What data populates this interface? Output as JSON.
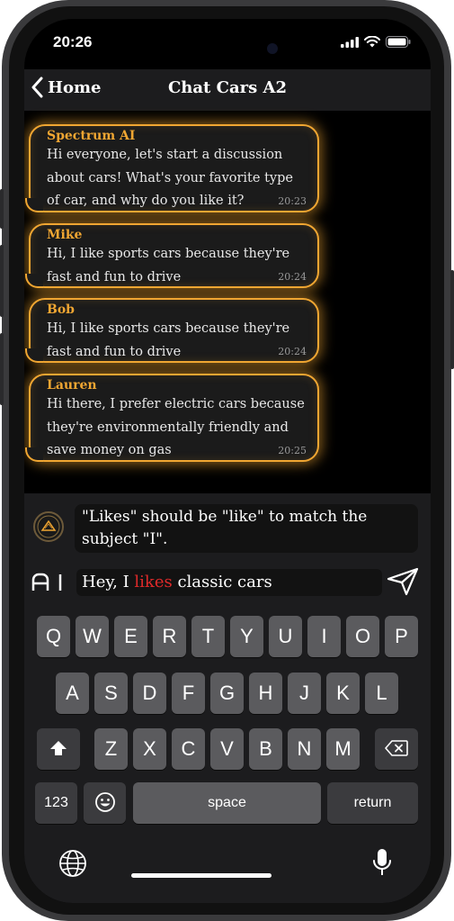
{
  "status": {
    "time": "20:26"
  },
  "nav": {
    "back_label": "Home",
    "title": "Chat Cars A2"
  },
  "messages": [
    {
      "sender": "Spectrum AI",
      "text": "Hi everyone, let's start a discussion about cars! What's your favorite type of car, and why do you like it?",
      "time": "20:23"
    },
    {
      "sender": "Mike",
      "text": "Hi, I like sports cars because they're fast and fun to drive",
      "time": "20:24"
    },
    {
      "sender": "Bob",
      "text": "Hi, I like sports cars because they're fast and fun to drive",
      "time": "20:24"
    },
    {
      "sender": "Lauren",
      "text": "Hi there, I prefer electric cars because they're environmentally friendly and save money on gas",
      "time": "20:25"
    }
  ],
  "correction": {
    "text": "\"Likes\" should be \"like\" to match the subject \"I\"."
  },
  "input": {
    "before": "Hey, I ",
    "error_word": "likes",
    "after": " classic cars"
  },
  "keyboard": {
    "row1": [
      "Q",
      "W",
      "E",
      "R",
      "T",
      "Y",
      "U",
      "I",
      "O",
      "P"
    ],
    "row2": [
      "A",
      "S",
      "D",
      "F",
      "G",
      "H",
      "J",
      "K",
      "L"
    ],
    "row3": [
      "Z",
      "X",
      "C",
      "V",
      "B",
      "N",
      "M"
    ],
    "numbers_label": "123",
    "space_label": "space",
    "return_label": "return"
  },
  "colors": {
    "accent": "#f0a632",
    "error": "#e02a2a"
  }
}
